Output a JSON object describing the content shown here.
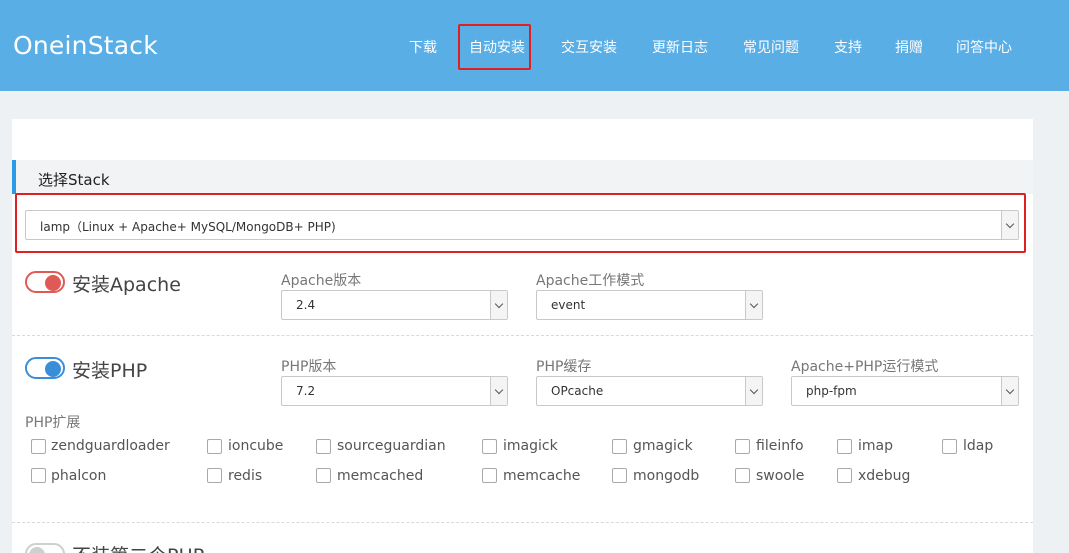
{
  "header": {
    "logo": "OneinStack",
    "nav": [
      "下载",
      "自动安装",
      "交互安装",
      "更新日志",
      "常见问题",
      "支持",
      "捐赠",
      "问答中心"
    ],
    "active_nav": "自动安装"
  },
  "stack": {
    "title": "选择Stack",
    "selected": "lamp（Linux + Apache+ MySQL/MongoDB+ PHP)"
  },
  "apache": {
    "toggle_label": "安装Apache",
    "toggle_on": true,
    "version_label": "Apache版本",
    "version_value": "2.4",
    "mode_label": "Apache工作模式",
    "mode_value": "event"
  },
  "php": {
    "toggle_label": "安装PHP",
    "toggle_on": true,
    "version_label": "PHP版本",
    "version_value": "7.2",
    "cache_label": "PHP缓存",
    "cache_value": "OPcache",
    "run_mode_label": "Apache+PHP运行模式",
    "run_mode_value": "php-fpm",
    "ext_label": "PHP扩展",
    "extensions": [
      "zendguardloader",
      "ioncube",
      "sourceguardian",
      "imagick",
      "gmagick",
      "fileinfo",
      "imap",
      "ldap",
      "phalcon",
      "redis",
      "memcached",
      "memcache",
      "mongodb",
      "swoole",
      "xdebug"
    ]
  },
  "php_extra": {
    "toggle_label": "不装第二个PHP"
  },
  "colors": {
    "header_bg": "#5aaee6",
    "accent": "#2d9ae6",
    "highlight": "#e02020"
  }
}
